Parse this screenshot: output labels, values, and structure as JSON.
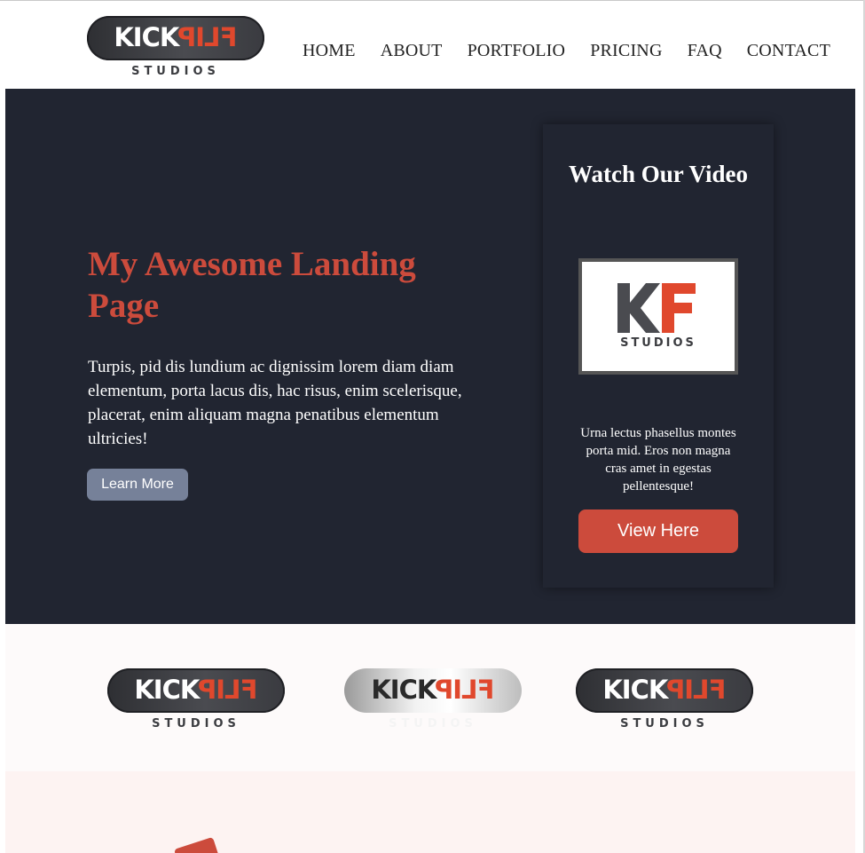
{
  "header": {
    "logo": {
      "word_kick": "KICK",
      "word_flip": "FLIP",
      "sub": "STUDIOS"
    },
    "nav": [
      "HOME",
      "ABOUT",
      "PORTFOLIO",
      "PRICING",
      "FAQ",
      "CONTACT"
    ]
  },
  "hero": {
    "title": "My Awesome Landing Page",
    "text": "Turpis, pid dis lundium ac dignissim lorem diam diam elementum, porta lacus dis, hac risus, enim scelerisque, placerat, enim aliquam magna penatibus elementum ultricies!",
    "learn_more": "Learn More",
    "accent_color": "#cc4b3c",
    "background_color": "#212531"
  },
  "video_card": {
    "title": "Watch Our Video",
    "thumb_sub": "STUDIOS",
    "text": "Urna lectus phasellus montes porta mid. Eros non magna cras amet in egestas pellentesque!",
    "button": "View Here"
  },
  "logos": [
    {
      "word_kick": "KICK",
      "word_flip": "FLIP",
      "sub": "STUDIOS",
      "style": "dark"
    },
    {
      "word_kick": "KICK",
      "word_flip": "FLIP",
      "sub": "STUDIOS",
      "style": "silver"
    },
    {
      "word_kick": "KICK",
      "word_flip": "FLIP",
      "sub": "STUDIOS",
      "style": "dark"
    }
  ]
}
